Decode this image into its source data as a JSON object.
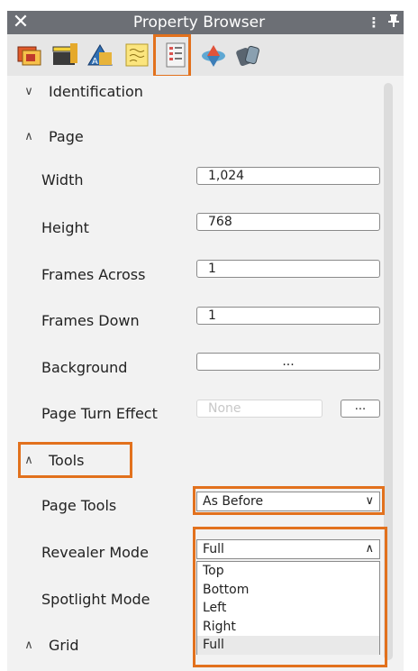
{
  "window": {
    "title": "Property Browser",
    "close_glyph": "✕",
    "menu_glyph": "⋮",
    "pin_glyph": "📌"
  },
  "toolbar": {
    "icons": [
      "slides-icon",
      "scene-icon",
      "designer-icon",
      "notes-icon",
      "page-properties-icon",
      "spinner-icon",
      "devices-icon"
    ],
    "active": "page-properties-icon"
  },
  "sections": {
    "identification": "Identification",
    "page": "Page",
    "tools": "Tools",
    "grid": "Grid"
  },
  "page": {
    "width_label": "Width",
    "width_value": "1,024",
    "height_label": "Height",
    "height_value": "768",
    "frames_across_label": "Frames Across",
    "frames_across_value": "1",
    "frames_down_label": "Frames Down",
    "frames_down_value": "1",
    "background_label": "Background",
    "background_value": "...",
    "page_turn_label": "Page Turn Effect",
    "page_turn_placeholder": "None",
    "page_turn_button": "..."
  },
  "tools": {
    "page_tools_label": "Page Tools",
    "page_tools_value": "As Before",
    "revealer_label": "Revealer Mode",
    "revealer_value": "Full",
    "spotlight_label": "Spotlight Mode",
    "revealer_options": [
      "Top",
      "Bottom",
      "Left",
      "Right",
      "Full"
    ],
    "revealer_selected": "Full"
  },
  "colors": {
    "highlight": "#e2711d",
    "titlebar": "#6c6f75",
    "panel": "#f2f2f2"
  }
}
